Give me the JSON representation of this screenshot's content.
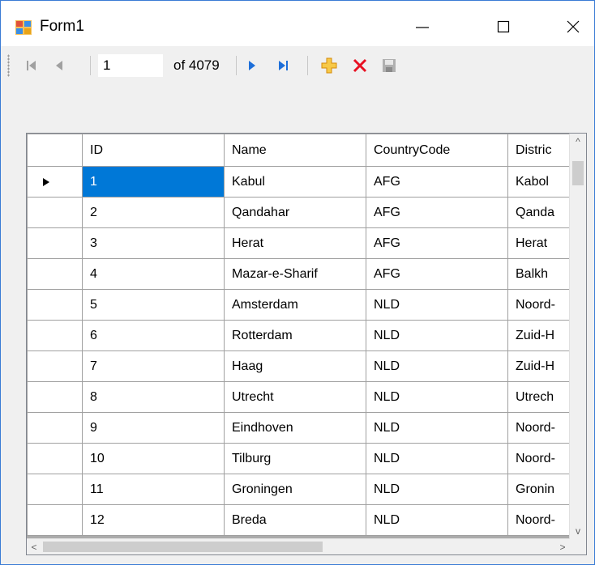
{
  "window": {
    "title": "Form1",
    "controls": {
      "minimize": "—",
      "maximize": "☐",
      "close": "✕"
    }
  },
  "navigator": {
    "position_value": "1",
    "count_label": "of 4079",
    "icons": [
      "move-first-icon",
      "move-previous-icon",
      "move-next-icon",
      "move-last-icon",
      "add-new-icon",
      "delete-icon",
      "save-icon"
    ],
    "accent_blue": "#1e6fd9",
    "add_color": "#e8a317",
    "delete_color": "#e81123"
  },
  "grid": {
    "columns": [
      "ID",
      "Name",
      "CountryCode",
      "Distric"
    ],
    "selected_row": 0,
    "selection_color": "#0078d7",
    "rows": [
      {
        "id": "1",
        "name": "Kabul",
        "code": "AFG",
        "district": "Kabol"
      },
      {
        "id": "2",
        "name": "Qandahar",
        "code": "AFG",
        "district": "Qanda"
      },
      {
        "id": "3",
        "name": "Herat",
        "code": "AFG",
        "district": "Herat"
      },
      {
        "id": "4",
        "name": "Mazar-e-Sharif",
        "code": "AFG",
        "district": "Balkh"
      },
      {
        "id": "5",
        "name": "Amsterdam",
        "code": "NLD",
        "district": "Noord-"
      },
      {
        "id": "6",
        "name": "Rotterdam",
        "code": "NLD",
        "district": "Zuid-H"
      },
      {
        "id": "7",
        "name": "Haag",
        "code": "NLD",
        "district": "Zuid-H"
      },
      {
        "id": "8",
        "name": "Utrecht",
        "code": "NLD",
        "district": "Utrech"
      },
      {
        "id": "9",
        "name": "Eindhoven",
        "code": "NLD",
        "district": "Noord-"
      },
      {
        "id": "10",
        "name": "Tilburg",
        "code": "NLD",
        "district": "Noord-"
      },
      {
        "id": "11",
        "name": "Groningen",
        "code": "NLD",
        "district": "Gronin"
      },
      {
        "id": "12",
        "name": "Breda",
        "code": "NLD",
        "district": "Noord-"
      }
    ]
  },
  "scrollbars": {
    "up": "^",
    "down": "v",
    "left": "<",
    "right": ">"
  }
}
